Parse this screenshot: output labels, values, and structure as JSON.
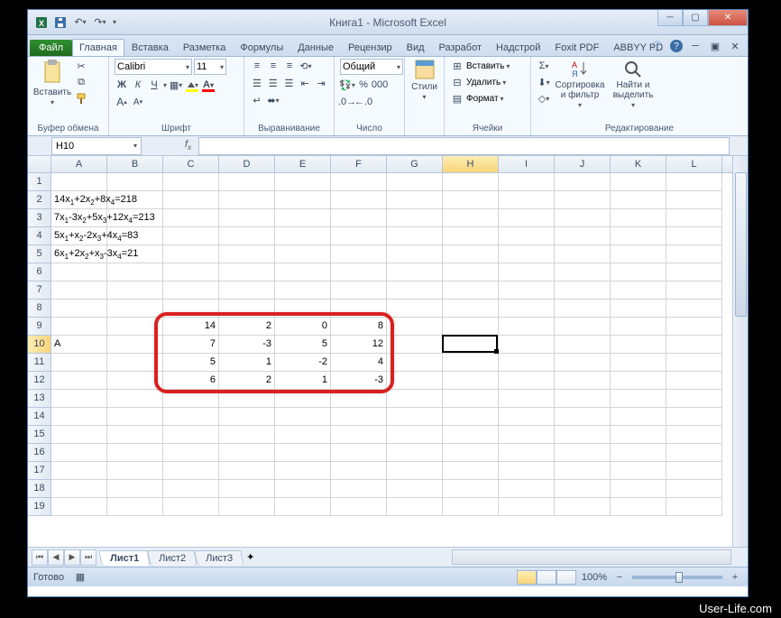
{
  "window": {
    "title": "Книга1 - Microsoft Excel"
  },
  "tabs": {
    "file": "Файл",
    "items": [
      "Главная",
      "Вставка",
      "Разметка",
      "Формулы",
      "Данные",
      "Рецензир",
      "Вид",
      "Разработ",
      "Надстрой",
      "Foxit PDF",
      "ABBYY PD"
    ],
    "active": 0
  },
  "ribbon": {
    "clipboard": {
      "label": "Буфер обмена",
      "paste": "Вставить"
    },
    "font": {
      "label": "Шрифт",
      "name": "Calibri",
      "size": "11",
      "bold": "Ж",
      "italic": "К",
      "underline": "Ч"
    },
    "alignment": {
      "label": "Выравнивание"
    },
    "number": {
      "label": "Число",
      "format": "Общий"
    },
    "styles": {
      "label": "Стили",
      "styles_btn": "Стили"
    },
    "cells": {
      "label": "Ячейки",
      "insert": "Вставить",
      "delete": "Удалить",
      "format": "Формат"
    },
    "editing": {
      "label": "Редактирование",
      "sort": "Сортировка и фильтр",
      "find": "Найти и выделить"
    }
  },
  "namebox": {
    "ref": "H10"
  },
  "columns": [
    "A",
    "B",
    "C",
    "D",
    "E",
    "F",
    "G",
    "H",
    "I",
    "J",
    "K",
    "L"
  ],
  "selected_col_index": 7,
  "cells": {
    "A2": "14x₁+2x₂+8x₄=218",
    "A3": "7x₁-3x₂+5x₃+12x₄=213",
    "A4": "5x₁+x₂-2x₃+4x₄=83",
    "A5": "6x₁+2x₂+x₃-3x₄=21",
    "A10": "A",
    "C9": "14",
    "D9": "2",
    "E9": "0",
    "F9": "8",
    "C10": "7",
    "D10": "-3",
    "E10": "5",
    "F10": "12",
    "C11": "5",
    "D11": "1",
    "E11": "-2",
    "F11": "4",
    "C12": "6",
    "D12": "2",
    "E12": "1",
    "F12": "-3"
  },
  "active_cell": {
    "row": 10,
    "col": 7
  },
  "selected_row_index": 10,
  "red_box": {
    "top_row": 9,
    "left_col": 2,
    "bottom_row": 12,
    "right_col": 5
  },
  "sheets": {
    "items": [
      "Лист1",
      "Лист2",
      "Лист3"
    ],
    "active": 0
  },
  "status": {
    "ready": "Готово",
    "zoom": "100%"
  },
  "watermark": "User-Life.com",
  "chart_data": {
    "type": "table",
    "title": "Matrix A (coefficient matrix)",
    "columns": [
      "x1",
      "x2",
      "x3",
      "x4"
    ],
    "rows": [
      [
        14,
        2,
        0,
        8
      ],
      [
        7,
        -3,
        5,
        12
      ],
      [
        5,
        1,
        -2,
        4
      ],
      [
        6,
        2,
        1,
        -3
      ]
    ],
    "equations_rhs": [
      218,
      213,
      83,
      21
    ]
  }
}
